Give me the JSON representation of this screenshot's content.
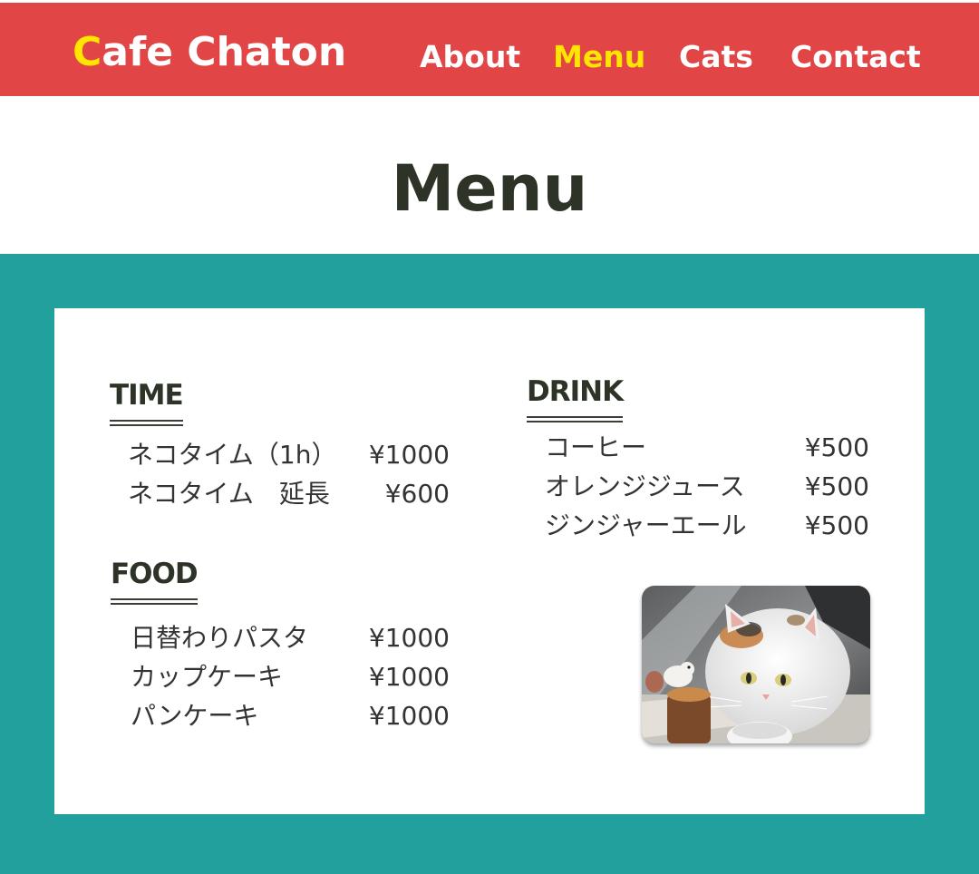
{
  "header": {
    "logo_initial": "C",
    "logo_rest": "afe Chaton",
    "nav": {
      "about": "About",
      "menu": "Menu",
      "cats": "Cats",
      "contact": "Contact"
    },
    "active_nav": "Menu"
  },
  "page_title": "Menu",
  "sections": {
    "time": {
      "heading": "TIME",
      "items": [
        {
          "name": "ネコタイム（1h）",
          "price": "¥1000"
        },
        {
          "name": "ネコタイム　延長",
          "price": "¥600"
        }
      ]
    },
    "food": {
      "heading": "FOOD",
      "items": [
        {
          "name": "日替わりパスタ",
          "price": "¥1000"
        },
        {
          "name": "カップケーキ",
          "price": "¥1000"
        },
        {
          "name": "パンケーキ",
          "price": "¥1000"
        }
      ]
    },
    "drink": {
      "heading": "DRINK",
      "items": [
        {
          "name": "コーヒー",
          "price": "¥500"
        },
        {
          "name": "オレンジジュース",
          "price": "¥500"
        },
        {
          "name": "ジンジャーエール",
          "price": "¥500"
        }
      ]
    }
  },
  "colors": {
    "header_bg": "#e14545",
    "accent_yellow": "#ffe600",
    "teal_bg": "#21a09d",
    "text_dark": "#2e3328"
  },
  "image": {
    "semantic": "cat-photo"
  }
}
